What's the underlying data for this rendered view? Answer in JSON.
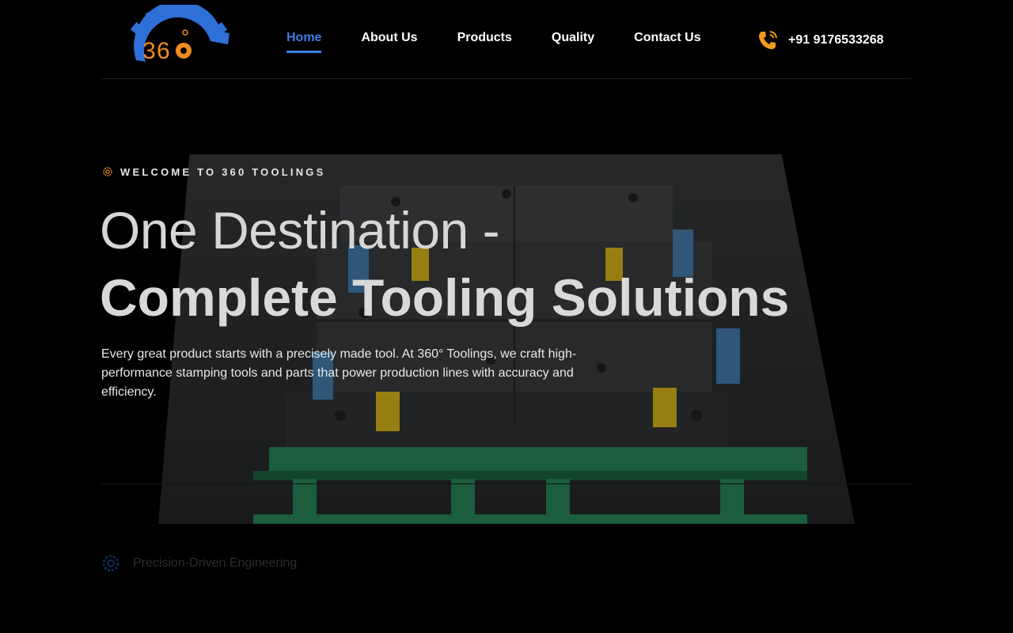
{
  "brand": {
    "logo_text": "360",
    "logo_icon": "gear-logo-icon"
  },
  "nav": {
    "items": [
      {
        "label": "Home",
        "active": true
      },
      {
        "label": "About Us",
        "active": false
      },
      {
        "label": "Products",
        "active": false
      },
      {
        "label": "Quality",
        "active": false
      },
      {
        "label": "Contact Us",
        "active": false
      }
    ]
  },
  "contact": {
    "phone": "+91 9176533268",
    "icon": "phone-icon"
  },
  "hero": {
    "eyebrow": "WELCOME TO 360 TOOLINGS",
    "title_light": "One Destination -",
    "title_bold": "Complete Tooling Solutions",
    "description": "Every great product starts with a precisely made tool. At 360° Toolings, we craft high-performance stamping tools and parts that power production lines with accuracy and efficiency."
  },
  "features": [
    {
      "label": "Precision-Driven Engineering",
      "icon": "gear-icon"
    }
  ],
  "colors": {
    "background": "#000000",
    "accent": "#3f7fe6",
    "logo_blue": "#2f6fd8",
    "logo_orange": "#f08c1c",
    "phone_orange": "#f09a1a",
    "die_green": "#2a8f5c",
    "die_yellow": "#e8c21a"
  }
}
